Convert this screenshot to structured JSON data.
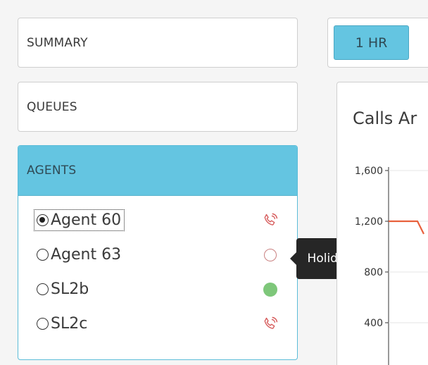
{
  "sidebar": {
    "summary_label": "SUMMARY",
    "queues_label": "QUEUES",
    "agents_label": "AGENTS",
    "agents": [
      {
        "name": "Agent 60",
        "selected": true,
        "status_icon": "phone-ringing-icon",
        "status_color": "#d65b5b"
      },
      {
        "name": "Agent 63",
        "selected": false,
        "status_icon": "status-ring-icon",
        "status_color": "#c98080"
      },
      {
        "name": "SL2b",
        "selected": false,
        "status_icon": "status-dot-icon",
        "status_color": "#7ec77a"
      },
      {
        "name": "SL2c",
        "selected": false,
        "status_icon": "phone-ringing-icon",
        "status_color": "#d65b5b"
      }
    ]
  },
  "tooltip": {
    "text": "Holiday"
  },
  "toolbar": {
    "range_label": "1 HR"
  },
  "colors": {
    "accent": "#64c5e1",
    "series_line": "#e8603c"
  },
  "chart_data": {
    "type": "line",
    "title": "Calls Ar",
    "y_ticks": [
      "1,600",
      "1,200",
      "800",
      "400"
    ],
    "ylim": [
      0,
      1600
    ],
    "series": [
      {
        "values": [
          1200,
          1200,
          1200,
          1100
        ]
      }
    ]
  }
}
